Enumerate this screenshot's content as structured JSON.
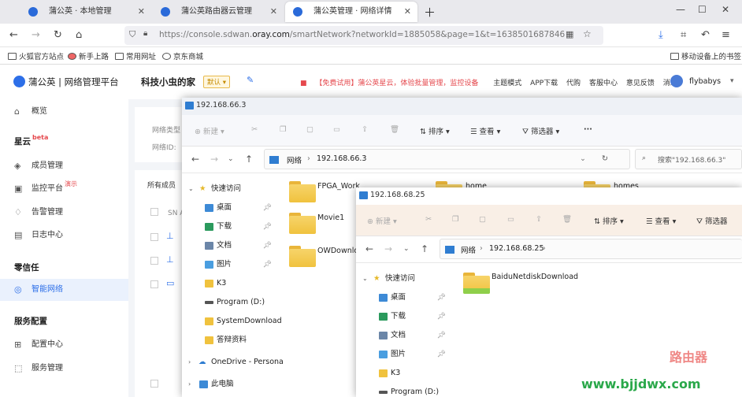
{
  "browser": {
    "tabs": [
      {
        "label": "蒲公英 · 本地管理"
      },
      {
        "label": "蒲公英路由器云管理"
      },
      {
        "label": "蒲公英管理 · 网络详情"
      }
    ],
    "url_prefix": "https://console.sdwan.",
    "url_domain": "oray.com",
    "url_suffix": "/smartNetwork?networkId=1885058&page=1&t=1638501687846",
    "bookmarks": [
      "火狐官方站点",
      "新手上路",
      "常用网址",
      "京东商城"
    ],
    "mobile_bookmarks": "移动设备上的书签"
  },
  "app": {
    "logo": "蒲公英 | 网络管理平台",
    "page_title": "科技小虫的家",
    "badge": "默认",
    "promo": "【免费试用】蒲公英星云，体验批量管理，监控设备",
    "header_links": [
      "主题模式",
      "APP下载",
      "代购",
      "客服中心",
      "意见反馈",
      "消息"
    ],
    "username": "flybabys",
    "sidebar": {
      "overview": "概览",
      "sec_xingyun": "星云",
      "xingyun_tag": "beta",
      "members": "成员管理",
      "monitor": "监控平台",
      "monitor_tag": "演示",
      "alerts": "告警管理",
      "logs": "日志中心",
      "sec_zero": "零信任",
      "smartnet": "智能网络",
      "sec_service": "服务配置",
      "config": "配置中心",
      "service": "服务管理"
    },
    "behind": {
      "type_label": "网络类型",
      "id_label": "网络ID:",
      "all_members": "所有成员",
      "sn": "SN A"
    }
  },
  "explorer1": {
    "title": "192.168.66.3",
    "cmd": {
      "new": "新建",
      "sort": "排序",
      "view": "查看",
      "filter": "筛选器",
      "more": "···"
    },
    "crumb_net": "网络",
    "crumb_host": "192.168.66.3",
    "search": "搜索\"192.168.66.3\"",
    "nav": [
      {
        "label": "快速访问"
      },
      {
        "label": "桌面"
      },
      {
        "label": "下载"
      },
      {
        "label": "文档"
      },
      {
        "label": "图片"
      },
      {
        "label": "K3"
      },
      {
        "label": "Program (D:)"
      },
      {
        "label": "SystemDownload"
      },
      {
        "label": "答辩资料"
      },
      {
        "label": "OneDrive - Persona"
      },
      {
        "label": "此电脑"
      }
    ],
    "folders": [
      "FPGA_Work",
      "Movie1",
      "OWDownlo",
      "home",
      "homes"
    ]
  },
  "explorer2": {
    "title": "192.168.68.25",
    "cmd": {
      "new": "新建",
      "sort": "排序",
      "view": "查看",
      "filter": "筛选器"
    },
    "crumb_net": "网络",
    "crumb_host": "192.168.68.25",
    "nav": [
      {
        "label": "快速访问"
      },
      {
        "label": "桌面"
      },
      {
        "label": "下载"
      },
      {
        "label": "文档"
      },
      {
        "label": "图片"
      },
      {
        "label": "K3"
      },
      {
        "label": "Program (D:)"
      }
    ],
    "folders": [
      "BaiduNetdiskDownload"
    ]
  },
  "watermark": "www.bjjdwx.com",
  "watermark_logo": "路由器"
}
